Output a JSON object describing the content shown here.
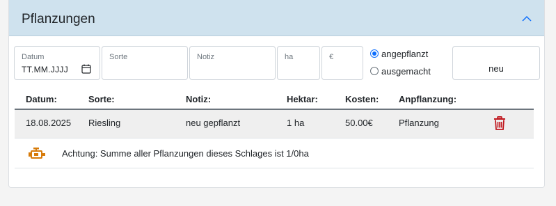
{
  "panel": {
    "title": "Pflanzungen"
  },
  "icons": {
    "collapse": "chevron-up-icon",
    "calendar": "calendar-icon",
    "delete": "trash-icon",
    "warning": "engine-warning-icon"
  },
  "colors": {
    "header_bg": "#cfe2ee",
    "accent": "#0d6efd",
    "delete": "#c0181f",
    "warning": "#d77b0a"
  },
  "form": {
    "date": {
      "label": "Datum",
      "value": "TT.MM.JJJJ"
    },
    "sorte": {
      "placeholder": "Sorte"
    },
    "notiz": {
      "placeholder": "Notiz"
    },
    "ha": {
      "placeholder": "ha"
    },
    "euro": {
      "placeholder": "€"
    },
    "radios": [
      {
        "label": "angepflanzt",
        "checked": true
      },
      {
        "label": "ausgemacht",
        "checked": false
      }
    ],
    "new_button": "neu"
  },
  "table": {
    "headers": [
      "Datum:",
      "Sorte:",
      "Notiz:",
      "Hektar:",
      "Kosten:",
      "Anpflanzung:"
    ],
    "rows": [
      [
        "18.08.2025",
        "Riesling",
        "neu gepflanzt",
        "1 ha",
        "50.00€",
        "Pflanzung"
      ]
    ]
  },
  "warning": {
    "text": "Achtung: Summe aller Pflanzungen dieses Schlages ist 1/0ha"
  }
}
